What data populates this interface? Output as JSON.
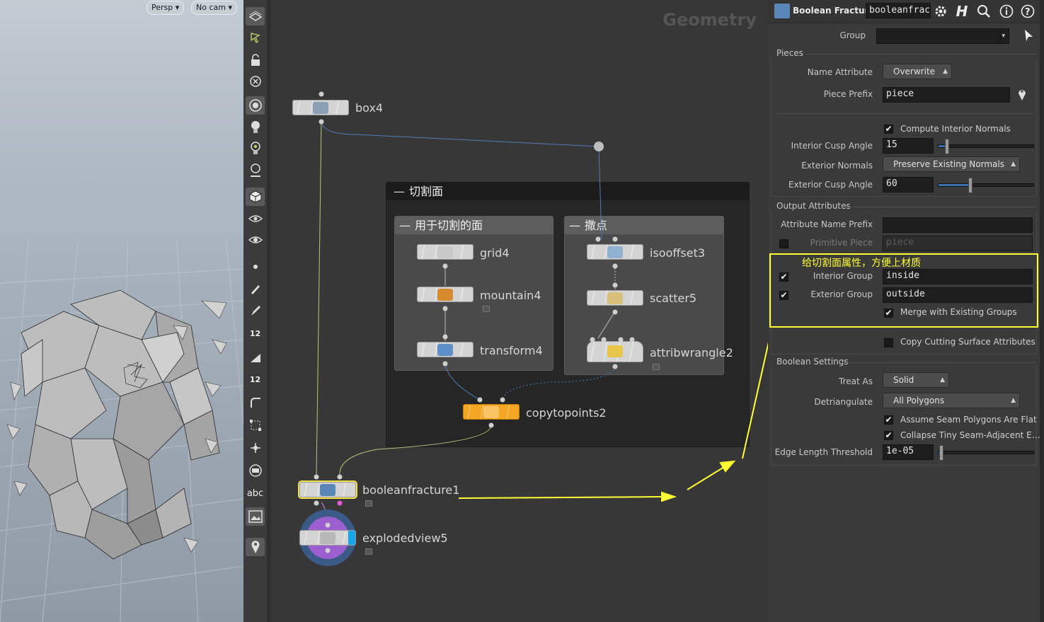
{
  "viewport": {
    "view_menu": "Persp",
    "camera_menu": "No cam"
  },
  "toolbar": {
    "tools": [
      "display-options-icon",
      "select-icon",
      "lock-icon",
      "ghost-icon",
      "camera-icon",
      "light-icon",
      "bulb-icon",
      "head-light-icon",
      "shaded-mode-icon",
      "eye-icon",
      "eye-link-icon",
      "dot-icon",
      "brush-icon",
      "pencil-icon",
      "measure-icon",
      "ruler-icon",
      "path-icon",
      "snap-icon",
      "transform-icon",
      "stack-icon",
      "text-icon",
      "image-icon",
      "pin-icon"
    ],
    "labels": {
      "num1": "12",
      "num2": "12",
      "text_tool": "abc"
    }
  },
  "network": {
    "context_title": "Geometry",
    "nodes": {
      "box": "box4",
      "grid": "grid4",
      "mountain": "mountain4",
      "transform": "transform4",
      "isooffset": "isooffset3",
      "scatter": "scatter5",
      "attribwrangle": "attribwrangle2",
      "copytopoints": "copytopoints2",
      "booleanfracture": "booleanfracture1",
      "explodedview": "explodedview5"
    },
    "boxes": {
      "outer": "切割面",
      "left": "用于切割的面",
      "right": "撒点"
    }
  },
  "params": {
    "header": {
      "node_type": "Boolean Fracture",
      "node_name": "booleanfrac"
    },
    "group_label": "Group",
    "pieces": {
      "section": "Pieces",
      "name_attribute_label": "Name Attribute",
      "name_attribute_value": "Overwrite",
      "piece_prefix_label": "Piece Prefix",
      "piece_prefix_value": "piece",
      "compute_interior_normals": "Compute Interior Normals",
      "interior_cusp_label": "Interior Cusp Angle",
      "interior_cusp_value": "15",
      "interior_cusp_fraction": 0.08,
      "exterior_normals_label": "Exterior Normals",
      "exterior_normals_value": "Preserve Existing Normals",
      "exterior_cusp_label": "Exterior Cusp Angle",
      "exterior_cusp_value": "60",
      "exterior_cusp_fraction": 0.33
    },
    "output": {
      "section": "Output Attributes",
      "attr_prefix_label": "Attribute Name Prefix",
      "primitive_piece_label": "Primitive Piece",
      "primitive_piece_value": "piece",
      "annotation": "给切割面属性，方便上材质",
      "interior_group_label": "Interior Group",
      "interior_group_value": "inside",
      "exterior_group_label": "Exterior Group",
      "exterior_group_value": "outside",
      "merge_groups": "Merge with Existing Groups",
      "copy_cutting": "Copy Cutting Surface Attributes"
    },
    "boolean": {
      "section": "Boolean Settings",
      "treat_as_label": "Treat As",
      "treat_as_value": "Solid",
      "detriangulate_label": "Detriangulate",
      "detriangulate_value": "All Polygons",
      "assume_seam": "Assume Seam Polygons Are Flat",
      "collapse_tiny": "Collapse Tiny Seam-Adjacent E…",
      "edge_threshold_label": "Edge Length Threshold",
      "edge_threshold_value": "1e-05",
      "edge_threshold_fraction": 0.02
    }
  },
  "colors": {
    "annotation_yellow": "#ffff33",
    "node_orange": "#f5a623",
    "slider_blue": "#3b6fb0",
    "explode_purple": "#9b5fd0"
  }
}
